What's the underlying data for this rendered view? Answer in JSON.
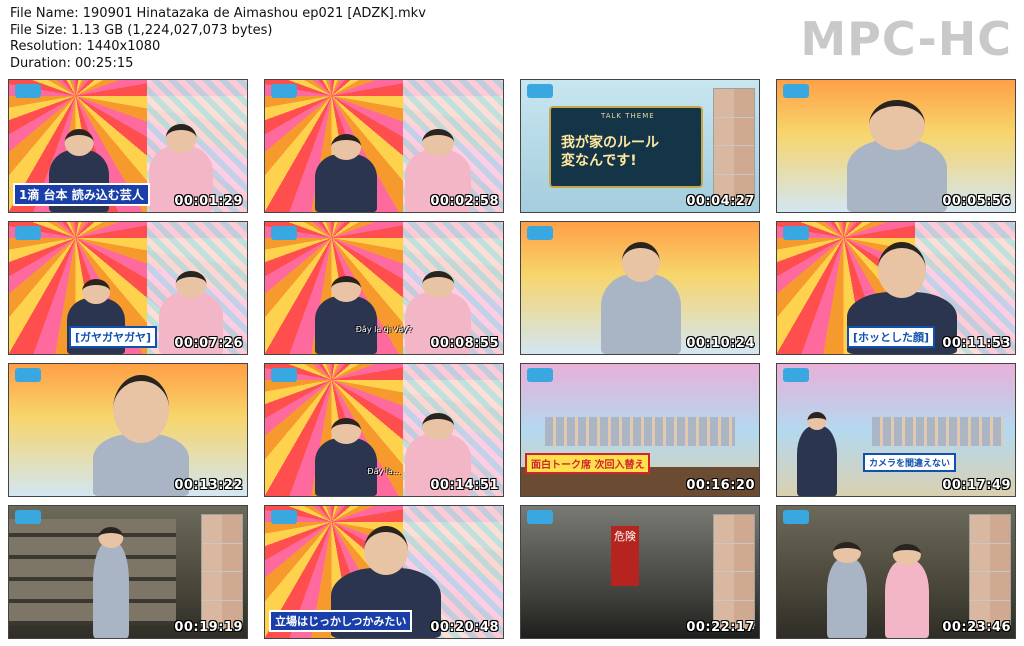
{
  "header": {
    "file_name": "File Name: 190901 Hinatazaka de Aimashou ep021 [ADZK].mkv",
    "file_size": "File Size: 1.13 GB (1,224,027,073 bytes)",
    "resolution": "Resolution: 1440x1080",
    "duration": "Duration: 00:25:15",
    "brand": "MPC-HC"
  },
  "thumbnails": [
    {
      "time": "00:01:29",
      "scene": "stage",
      "telop": "1滴 台本 読み込む芸人",
      "caption": ""
    },
    {
      "time": "00:02:58",
      "scene": "stage",
      "telop": "",
      "caption": ""
    },
    {
      "time": "00:04:27",
      "scene": "panel",
      "panel_label": "TALK THEME",
      "panel_text_1": "我が家のルール",
      "panel_text_2": "変なんです!",
      "caption": ""
    },
    {
      "time": "00:05:56",
      "scene": "closeup",
      "telop": "",
      "caption": ""
    },
    {
      "time": "00:07:26",
      "scene": "stage",
      "telop": "[ガヤガヤガヤ]",
      "caption": ""
    },
    {
      "time": "00:08:55",
      "scene": "stage",
      "telop": "",
      "caption": "Đây là gì vậy?"
    },
    {
      "time": "00:10:24",
      "scene": "stage2",
      "telop": "",
      "caption": ""
    },
    {
      "time": "00:11:53",
      "scene": "closeup",
      "telop": "[ホッとした顔]",
      "caption": ""
    },
    {
      "time": "00:13:22",
      "scene": "closeup",
      "telop": "",
      "caption": ""
    },
    {
      "time": "00:14:51",
      "scene": "stage",
      "telop": "",
      "caption": "Đây là..."
    },
    {
      "time": "00:16:20",
      "scene": "studio",
      "telop": "面白トーク席 次回入替え",
      "caption": ""
    },
    {
      "time": "00:17:49",
      "scene": "studio",
      "telop": "カメラを間違えない",
      "caption": ""
    },
    {
      "time": "00:19:19",
      "scene": "warehouse",
      "telop": "",
      "caption": ""
    },
    {
      "time": "00:20:48",
      "scene": "stage",
      "telop": "立場はじっかしつかみたい",
      "caption": ""
    },
    {
      "time": "00:22:17",
      "scene": "dark",
      "sign": "危険",
      "telop": "",
      "caption": ""
    },
    {
      "time": "00:23:46",
      "scene": "warehouse",
      "telop": "",
      "caption": ""
    }
  ]
}
